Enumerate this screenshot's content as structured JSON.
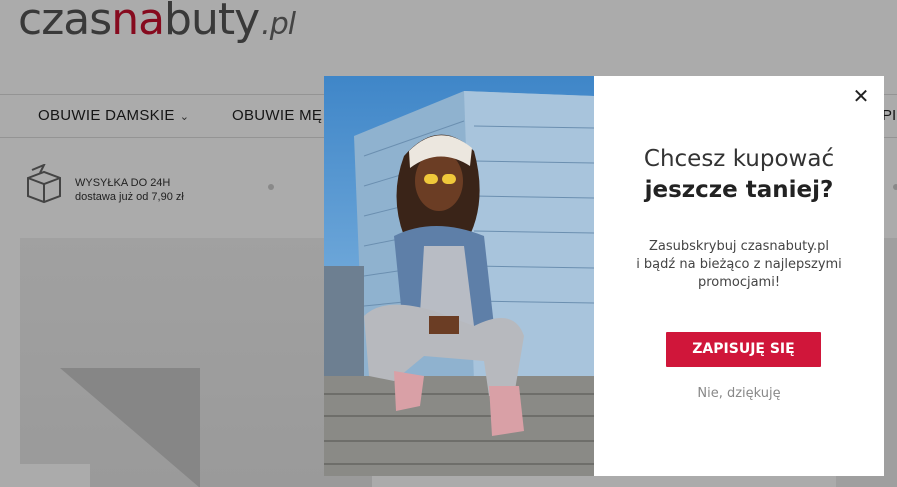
{
  "logo": {
    "part1": "czas",
    "part2": "na",
    "part3": "buty",
    "tld": ".pl"
  },
  "nav": {
    "items": [
      {
        "label": "OBUWIE DAMSKIE"
      },
      {
        "label": "OBUWIE MĘ"
      }
    ],
    "edge_label": "PI"
  },
  "shipping": {
    "title": "WYSYŁKA DO 24H",
    "subtitle": "dostawa już od 7,90 zł"
  },
  "modal": {
    "heading_line1": "Chcesz kupować",
    "heading_line2": "jeszcze taniej?",
    "body_line1": "Zasubskrybuj czasnabuty.pl",
    "body_line2": "i bądź na bieżąco z najlepszymi",
    "body_line3": "promocjami!",
    "subscribe_label": "ZAPISUJĘ SIĘ",
    "decline_label": "Nie, dziękuję",
    "close_symbol": "✕"
  },
  "colors": {
    "brand_red": "#c8102e",
    "button_red": "#d0163a"
  },
  "icons": [
    "box-icon",
    "chevron-down-icon",
    "close-icon"
  ]
}
